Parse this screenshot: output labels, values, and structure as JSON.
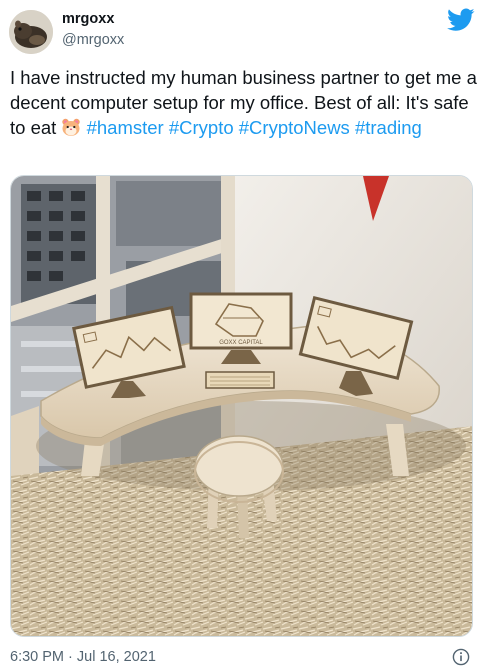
{
  "user": {
    "display_name": "mrgoxx",
    "handle": "@mrgoxx",
    "avatar_icon": "hamster-avatar"
  },
  "tweet": {
    "text_line": "I have instructed my human business partner to get me a decent computer setup for my office. Best of all: It's safe to eat",
    "emoji": "hamster-face-emoji",
    "hashtags": [
      "#hamster",
      "#Crypto",
      "#CryptoNews",
      "#trading"
    ],
    "timestamp": "6:30 PM · Jul 16, 2021"
  },
  "media": {
    "monitor_label": "GOXX CAPITAL"
  },
  "colors": {
    "link": "#1d9bf0",
    "twitter_blue": "#1d9bf0",
    "secondary_text": "#536471"
  },
  "icons": [
    "twitter-bird-icon",
    "info-icon"
  ]
}
